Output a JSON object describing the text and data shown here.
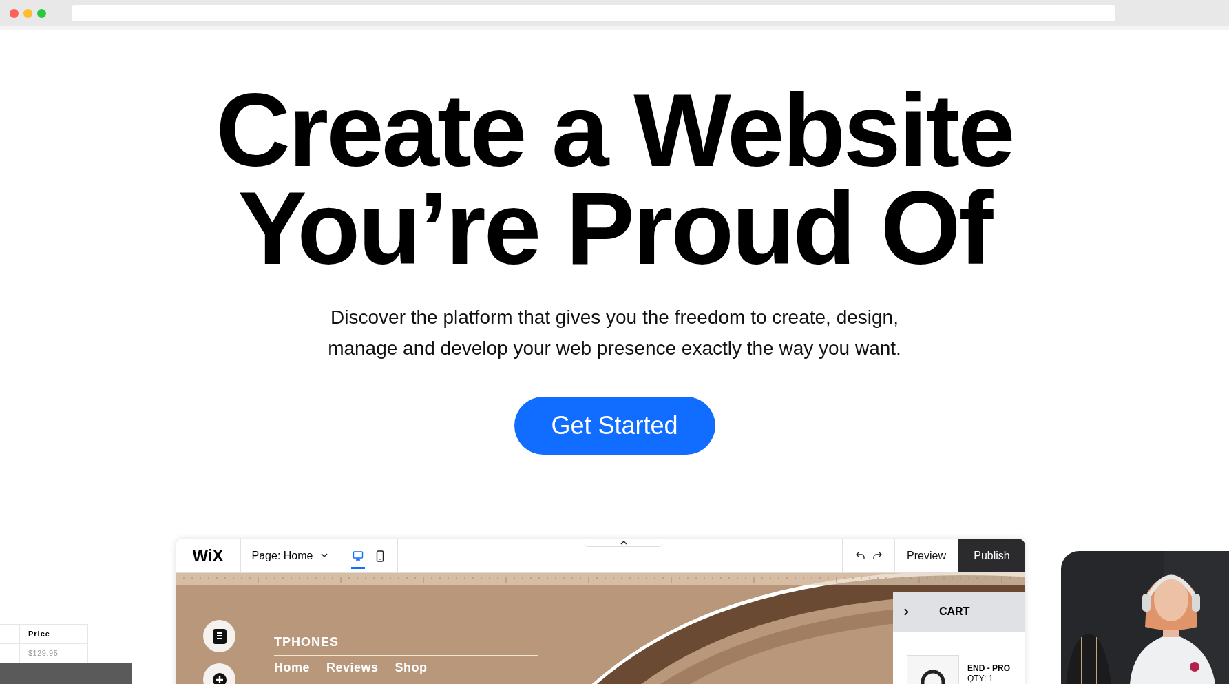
{
  "browser": {
    "dots": [
      {
        "color": "#fe5f57"
      },
      {
        "color": "#febc2e"
      },
      {
        "color": "#28c840"
      }
    ]
  },
  "hero": {
    "title_lines": [
      "Create a Website",
      "You’re Proud Of"
    ],
    "subtitle": "Discover the platform that gives you the freedom to create, design, manage and develop your web presence exactly the way you want.",
    "cta": "Get Started"
  },
  "editor": {
    "logo": "WiX",
    "page_selector": "Page: Home",
    "devices": [
      {
        "kind": "desktop",
        "selected": true
      },
      {
        "kind": "mobile",
        "selected": false
      }
    ],
    "actions": [
      {
        "label": "Preview",
        "kind": "secondary"
      },
      {
        "label": "Publish",
        "kind": "primary"
      }
    ],
    "site": {
      "brand": "TPHONES",
      "nav": [
        "Home",
        "Reviews",
        "Shop"
      ]
    },
    "cart": {
      "title": "CART",
      "items": [
        {
          "name": "END - PRO",
          "qty": "QTY: 1"
        }
      ]
    }
  },
  "price_card": {
    "header": "Price",
    "value": "$129.95"
  }
}
